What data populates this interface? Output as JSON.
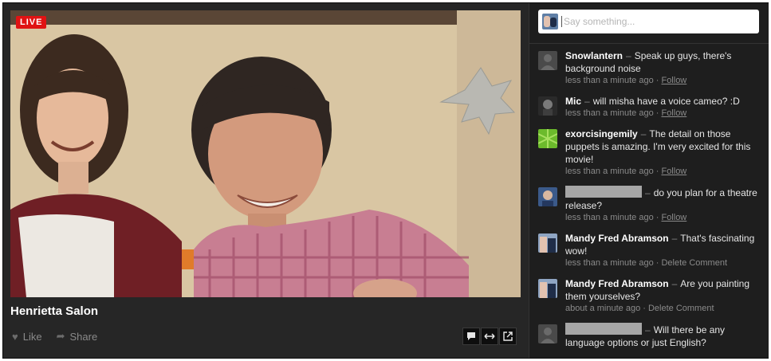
{
  "video": {
    "live_badge": "LIVE",
    "title": "Henrietta Salon"
  },
  "actions": {
    "like": "Like",
    "share": "Share"
  },
  "chat": {
    "placeholder": "Say something...",
    "comments": [
      {
        "name": "Snowlantern",
        "text": "Speak up guys, there's background noise",
        "time": "less than a minute ago",
        "action": "Follow",
        "avatar": "default-avatar-icon"
      },
      {
        "name": "Mic",
        "text": "will misha have a voice cameo? :D",
        "time": "less than a minute ago",
        "action": "Follow",
        "avatar": "user-photo-avatar"
      },
      {
        "name": "exorcisingemily",
        "text": "The detail on those puppets is amazing. I'm very excited for this movie!",
        "time": "less than a minute ago",
        "action": "Follow",
        "avatar": "green-pattern-avatar"
      },
      {
        "name": "",
        "text": "do you plan for a theatre release?",
        "time": "less than a minute ago",
        "action": "Follow",
        "avatar": "user-photo-avatar"
      },
      {
        "name": "Mandy Fred Abramson",
        "text": "That's fascinating wow!",
        "time": "less than a minute ago",
        "action": "Delete Comment",
        "avatar": "user-photo-avatar"
      },
      {
        "name": "Mandy Fred Abramson",
        "text": "Are you painting them yourselves?",
        "time": "about a minute ago",
        "action": "Delete Comment",
        "avatar": "user-photo-avatar"
      },
      {
        "name": "",
        "text": "Will there be any language options or just English?",
        "time": "",
        "action": "",
        "avatar": "default-avatar-icon"
      }
    ]
  },
  "controls": [
    "chat-icon",
    "expand-icon",
    "popout-icon"
  ]
}
